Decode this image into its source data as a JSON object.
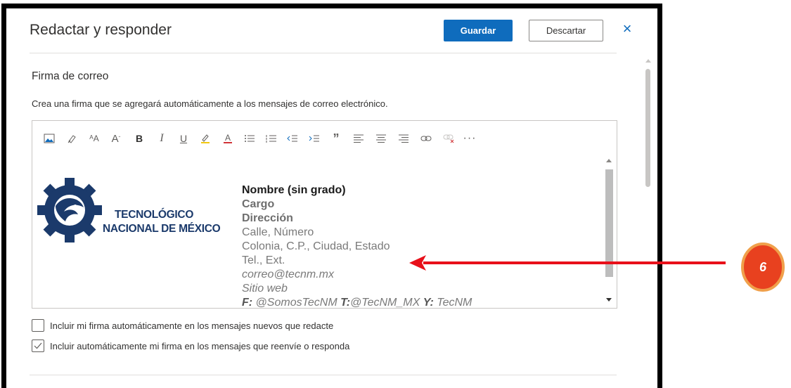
{
  "dialog": {
    "title": "Redactar y responder",
    "save_label": "Guardar",
    "discard_label": "Descartar",
    "close_icon": "×"
  },
  "signature": {
    "section_title": "Firma de correo",
    "description": "Crea una firma que se agregará automáticamente a los mensajes de correo electrónico.",
    "toolbar_icons": [
      "image-icon",
      "format-painter-icon",
      "font-size-icon",
      "grow-font-icon",
      "bold-icon",
      "italic-icon",
      "underline-icon",
      "highlight-icon",
      "font-color-icon",
      "bullets-icon",
      "numbering-icon",
      "decrease-indent-icon",
      "increase-indent-icon",
      "quote-icon",
      "align-left-icon",
      "align-center-icon",
      "align-right-icon",
      "link-icon",
      "remove-link-icon",
      "more-options-icon"
    ],
    "logo": {
      "line1": "TECNOLÓGICO",
      "line2": "NACIONAL DE MÉXICO"
    },
    "name": "Nombre (sin grado)",
    "cargo": "Cargo",
    "direccion": "Dirección",
    "calle": "Calle, Número",
    "colonia": "Colonia, C.P., Ciudad, Estado",
    "tel": "Tel., Ext.",
    "email": "correo@tecnm.mx",
    "web": "Sitio web",
    "social_f_label": "F:",
    "social_f_value": " @SomosTecNM ",
    "social_t_label": "T:",
    "social_t_value": "@TecNM_MX ",
    "social_y_label": "Y:",
    "social_y_value": " TecNM"
  },
  "options": {
    "auto_new": "Incluir mi firma automáticamente en los mensajes nuevos que redacte",
    "auto_new_checked": false,
    "auto_reply": "Incluir automáticamente mi firma en los mensajes que reenvíe o responda",
    "auto_reply_checked": true
  },
  "annotation": {
    "badge_number": "6",
    "badge_color": "#e8411f",
    "badge_ring_color": "#f0a04b",
    "arrow_color": "#e8101a"
  },
  "colors": {
    "primary": "#0f6cbd",
    "logo_blue": "#1b3a6b"
  }
}
